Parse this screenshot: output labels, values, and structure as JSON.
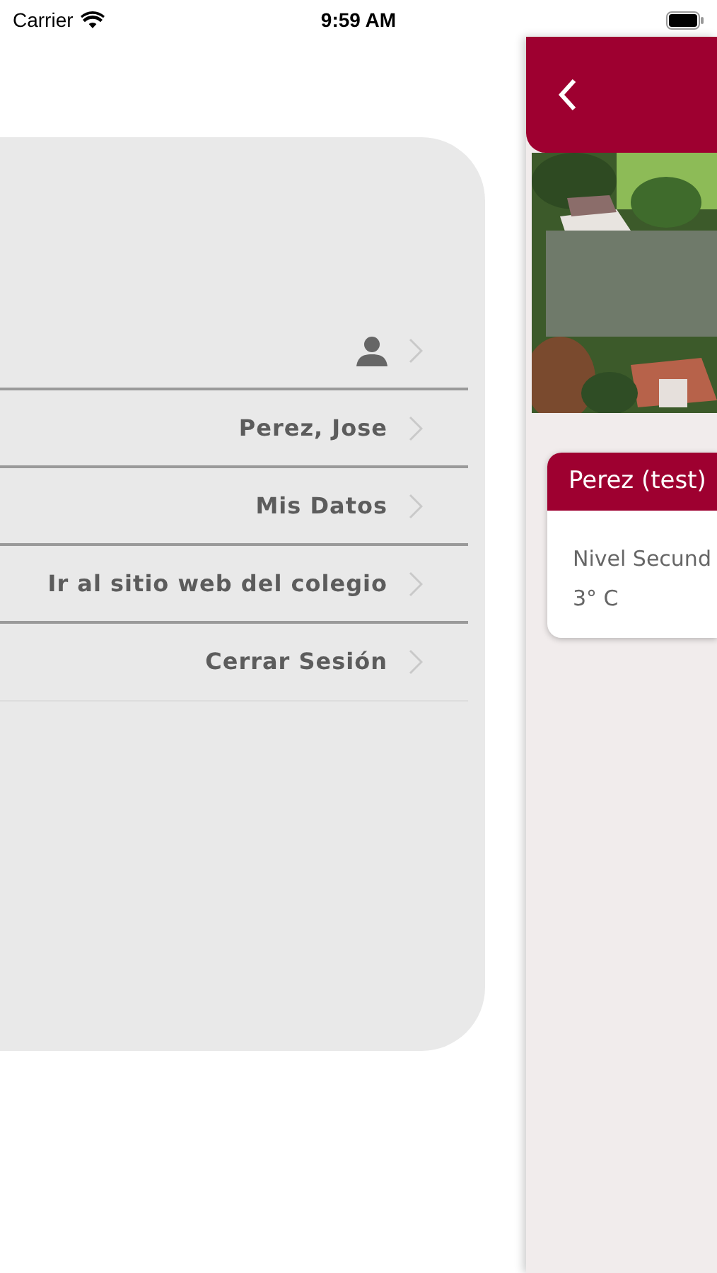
{
  "status_bar": {
    "carrier": "Carrier",
    "time": "9:59 AM"
  },
  "menu": {
    "items": [
      {
        "kind": "avatar"
      },
      {
        "kind": "link",
        "label": "Perez, Jose"
      },
      {
        "kind": "link",
        "label": "Mis Datos"
      },
      {
        "kind": "link",
        "label": "Ir al sitio web del colegio"
      },
      {
        "kind": "link",
        "label": "Cerrar Sesión"
      }
    ]
  },
  "main": {
    "student_card": {
      "name": "Perez (test)",
      "level": "Nivel Secund",
      "course": "3° C"
    }
  }
}
